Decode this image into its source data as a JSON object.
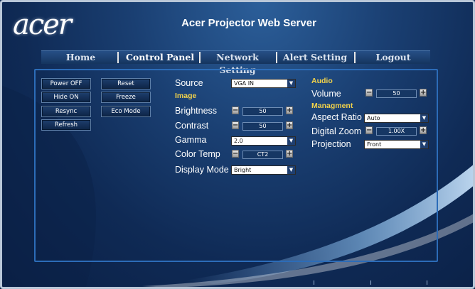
{
  "brand": {
    "logo": "acer",
    "title": "Acer Projector Web Server"
  },
  "nav": {
    "tabs": [
      "Home",
      "Control Panel",
      "Network Setting",
      "Alert Setting",
      "Logout"
    ],
    "active": "Control Panel"
  },
  "controls": {
    "buttons": [
      "Power OFF",
      "Reset",
      "Hide ON",
      "Freeze",
      "Resync",
      "Eco Mode",
      "Refresh"
    ]
  },
  "settings": {
    "source": {
      "label": "Source",
      "value": "VGA IN"
    },
    "image_heading": "Image",
    "brightness": {
      "label": "Brightness",
      "value": "50"
    },
    "contrast": {
      "label": "Contrast",
      "value": "50"
    },
    "gamma": {
      "label": "Gamma",
      "value": "2.0"
    },
    "color_temp": {
      "label": "Color Temp",
      "value": "CT2"
    },
    "display_mode": {
      "label": "Display Mode",
      "value": "Bright"
    },
    "audio_heading": "Audio",
    "volume": {
      "label": "Volume",
      "value": "50"
    },
    "management_heading": "Managment",
    "aspect_ratio": {
      "label": "Aspect Ratio",
      "value": "Auto"
    },
    "digital_zoom": {
      "label": "Digital Zoom",
      "value": "1.00X"
    },
    "projection": {
      "label": "Projection",
      "value": "Front"
    }
  },
  "icons": {
    "minus": "−",
    "plus": "+",
    "dropdown": "▼"
  },
  "colors": {
    "accent_heading": "#f2d24a",
    "panel_border": "#2c6cb8",
    "background": "#1a3f72"
  }
}
